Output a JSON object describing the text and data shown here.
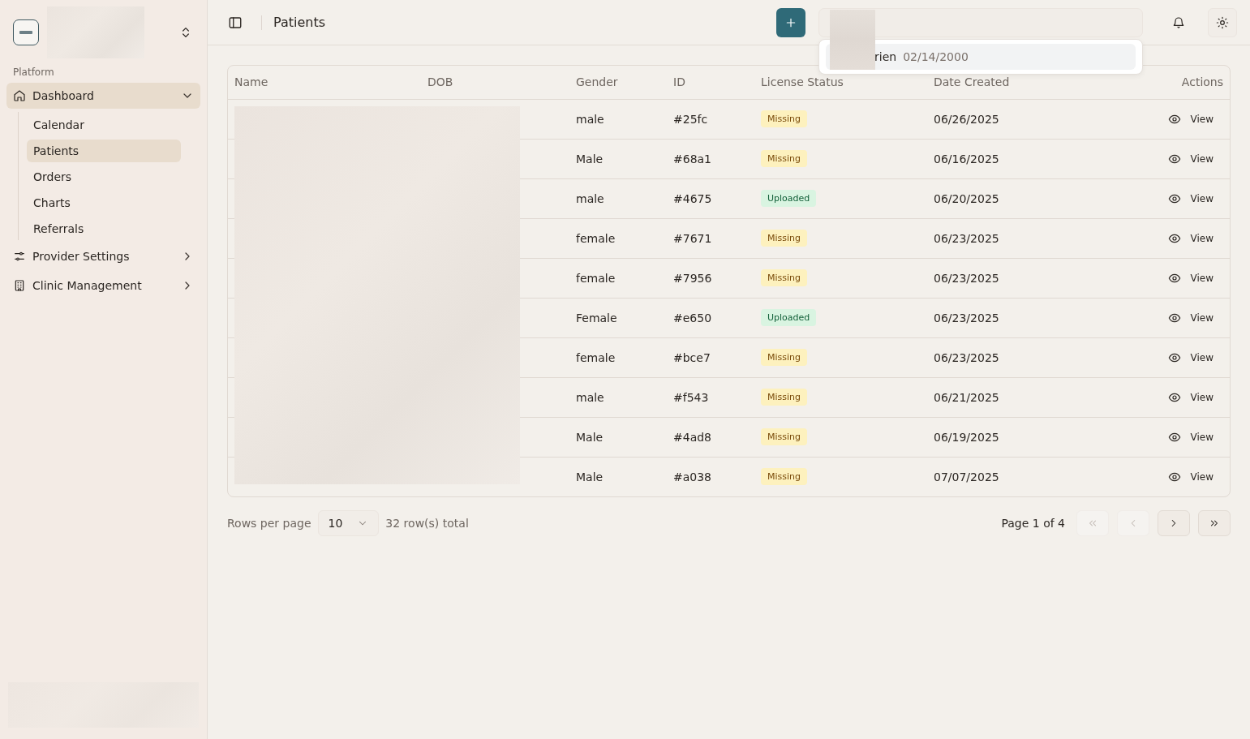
{
  "sidebar": {
    "section_label": "Platform",
    "items": [
      {
        "label": "Dashboard",
        "expanded": true,
        "selected": true,
        "children": [
          {
            "label": "Calendar",
            "selected": false
          },
          {
            "label": "Patients",
            "selected": true
          },
          {
            "label": "Orders",
            "selected": false
          },
          {
            "label": "Charts",
            "selected": false
          },
          {
            "label": "Referrals",
            "selected": false
          }
        ]
      },
      {
        "label": "Provider Settings",
        "expanded": false,
        "selected": false
      },
      {
        "label": "Clinic Management",
        "expanded": false,
        "selected": false
      }
    ]
  },
  "header": {
    "title": "Patients"
  },
  "search": {
    "suggestions": [
      {
        "name": "rien",
        "dob": "02/14/2000",
        "selected": true
      }
    ]
  },
  "table": {
    "columns": [
      "Name",
      "DOB",
      "Gender",
      "ID",
      "License Status",
      "Date Created",
      "Actions"
    ],
    "rows": [
      {
        "gender": "male",
        "id": "#25fc",
        "license_status": {
          "label": "Missing",
          "kind": "missing"
        },
        "date_created": "06/26/2025",
        "action": "View"
      },
      {
        "gender": "Male",
        "id": "#68a1",
        "license_status": {
          "label": "Missing",
          "kind": "missing"
        },
        "date_created": "06/16/2025",
        "action": "View"
      },
      {
        "gender": "male",
        "id": "#4675",
        "license_status": {
          "label": "Uploaded",
          "kind": "uploaded"
        },
        "date_created": "06/20/2025",
        "action": "View"
      },
      {
        "gender": "female",
        "id": "#7671",
        "license_status": {
          "label": "Missing",
          "kind": "missing"
        },
        "date_created": "06/23/2025",
        "action": "View"
      },
      {
        "gender": "female",
        "id": "#7956",
        "license_status": {
          "label": "Missing",
          "kind": "missing"
        },
        "date_created": "06/23/2025",
        "action": "View"
      },
      {
        "gender": "Female",
        "id": "#e650",
        "license_status": {
          "label": "Uploaded",
          "kind": "uploaded"
        },
        "date_created": "06/23/2025",
        "action": "View"
      },
      {
        "gender": "female",
        "id": "#bce7",
        "license_status": {
          "label": "Missing",
          "kind": "missing"
        },
        "date_created": "06/23/2025",
        "action": "View"
      },
      {
        "gender": "male",
        "id": "#f543",
        "license_status": {
          "label": "Missing",
          "kind": "missing"
        },
        "date_created": "06/21/2025",
        "action": "View"
      },
      {
        "gender": "Male",
        "id": "#4ad8",
        "license_status": {
          "label": "Missing",
          "kind": "missing"
        },
        "date_created": "06/19/2025",
        "action": "View"
      },
      {
        "gender": "Male",
        "id": "#a038",
        "license_status": {
          "label": "Missing",
          "kind": "missing"
        },
        "date_created": "07/07/2025",
        "action": "View"
      }
    ]
  },
  "pagination": {
    "rows_per_page_label": "Rows per page",
    "rows_per_page": "10",
    "total": "32 row(s) total",
    "page": "Page 1 of 4",
    "buttons": [
      {
        "kind": "first",
        "disabled": true
      },
      {
        "kind": "prev",
        "disabled": true
      },
      {
        "kind": "next",
        "disabled": false
      },
      {
        "kind": "last",
        "disabled": false
      }
    ]
  }
}
